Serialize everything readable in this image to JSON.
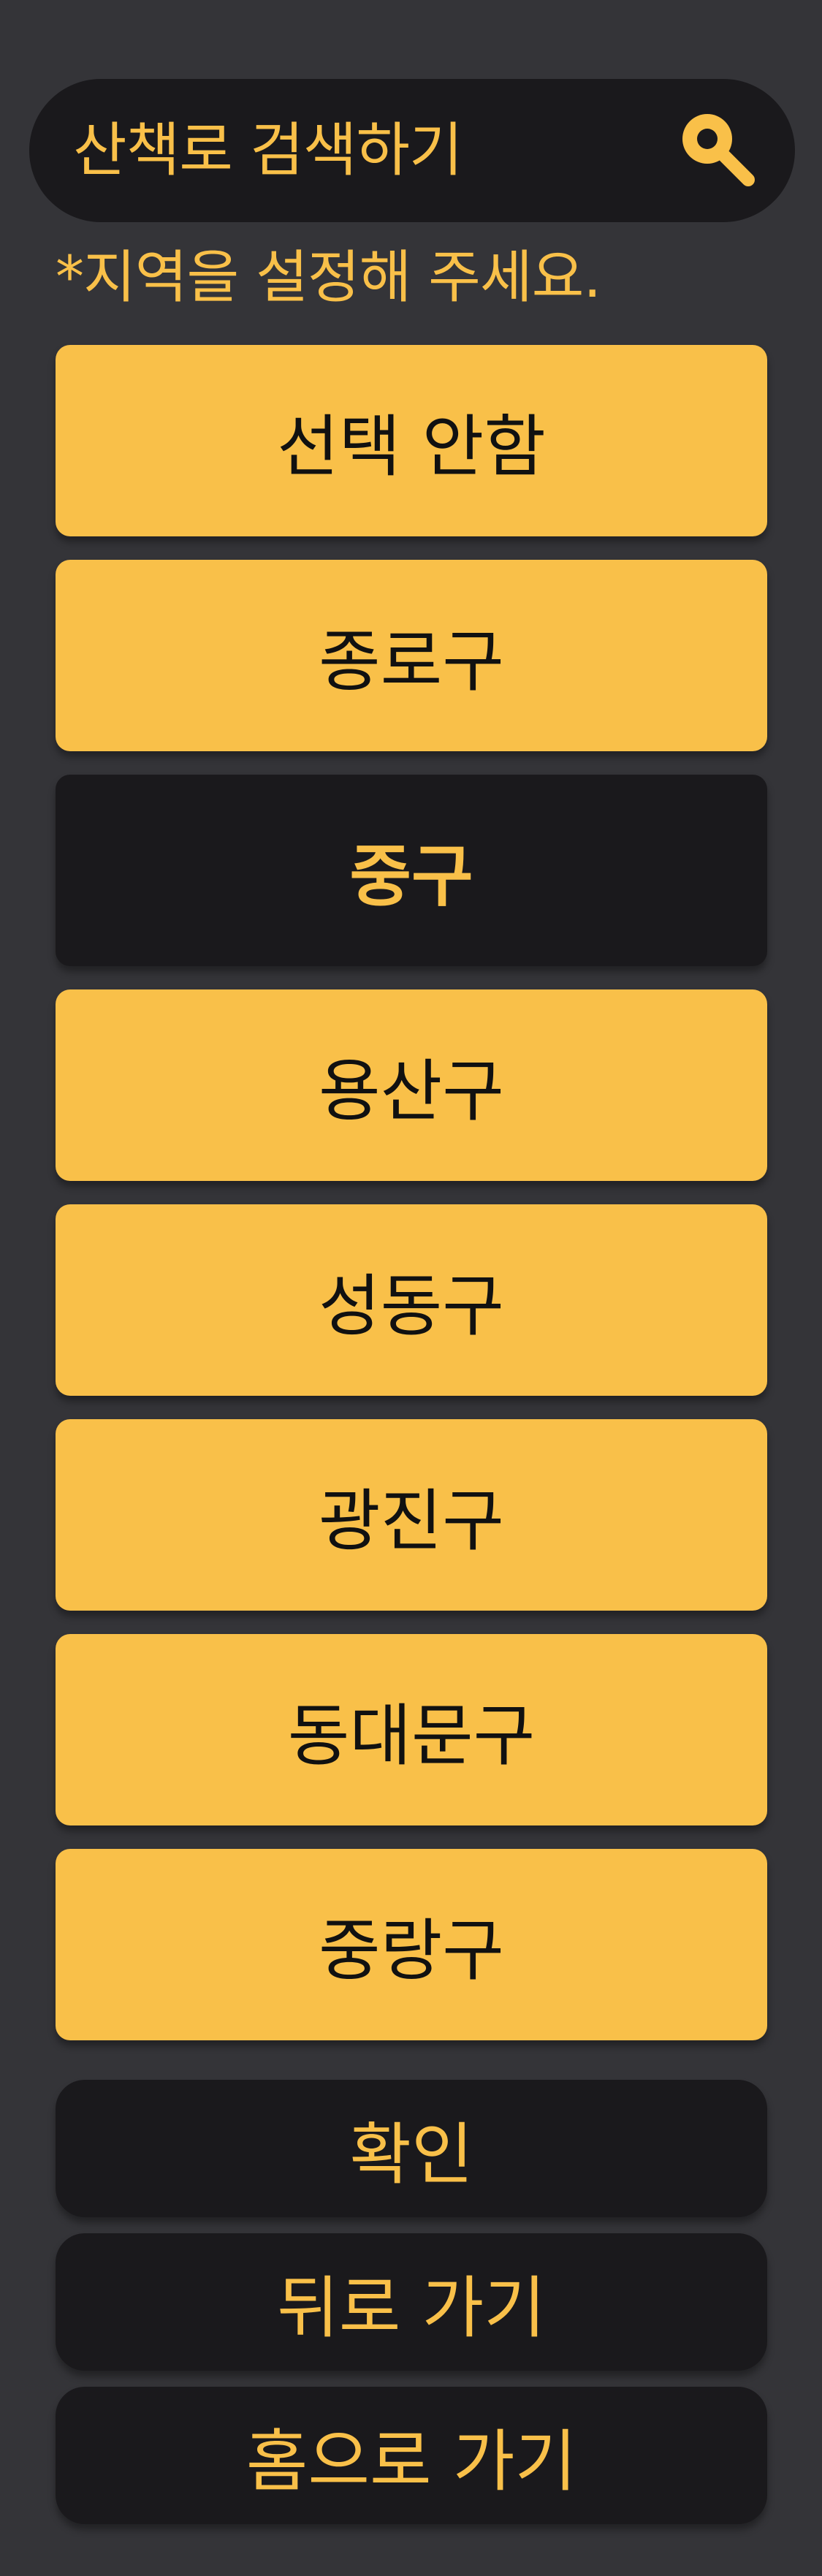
{
  "search": {
    "placeholder": "산책로 검색하기",
    "icon": "search-icon"
  },
  "hint": "*지역을 설정해 주세요.",
  "districts": [
    {
      "label": "선택 안함",
      "selected": false
    },
    {
      "label": "종로구",
      "selected": false
    },
    {
      "label": "중구",
      "selected": true
    },
    {
      "label": "용산구",
      "selected": false
    },
    {
      "label": "성동구",
      "selected": false
    },
    {
      "label": "광진구",
      "selected": false
    },
    {
      "label": "동대문구",
      "selected": false
    },
    {
      "label": "중랑구",
      "selected": false
    }
  ],
  "actions": {
    "confirm": "확인",
    "back": "뒤로 가기",
    "home": "홈으로 가기"
  },
  "colors": {
    "background": "#343438",
    "accent": "#f9c049",
    "dark": "#1a191c"
  }
}
